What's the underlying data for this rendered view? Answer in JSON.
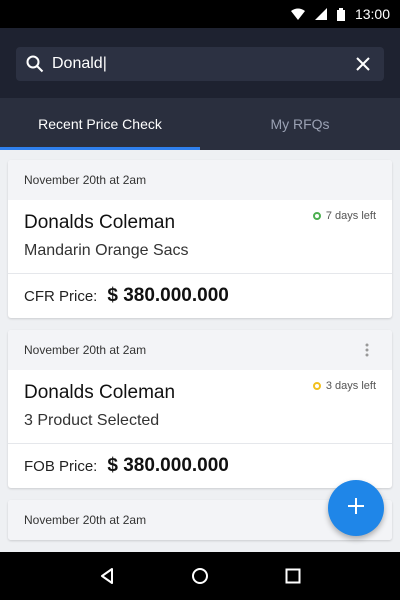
{
  "status_bar": {
    "time": "13:00"
  },
  "search": {
    "value": "Donald|",
    "placeholder": ""
  },
  "tabs": [
    {
      "label": "Recent Price Check",
      "active": true
    },
    {
      "label": "My RFQs",
      "active": false
    }
  ],
  "cards": [
    {
      "date": "November 20th at 2am",
      "name": "Donalds Coleman",
      "product": "Mandarin Orange Sacs",
      "days_left": "7 days left",
      "status_color": "#4caf50",
      "price_label": "CFR Price:",
      "price": "$ 380.000.000"
    },
    {
      "date": "November 20th at 2am",
      "name": "Donalds Coleman",
      "product": "3 Product Selected",
      "days_left": "3 days left",
      "status_color": "#f2c01e",
      "price_label": "FOB Price:",
      "price": "$ 380.000.000"
    },
    {
      "date": "November 20th at 2am"
    }
  ],
  "colors": {
    "accent": "#2f80ed",
    "fab": "#1f86e8",
    "header": "#1e2230"
  }
}
